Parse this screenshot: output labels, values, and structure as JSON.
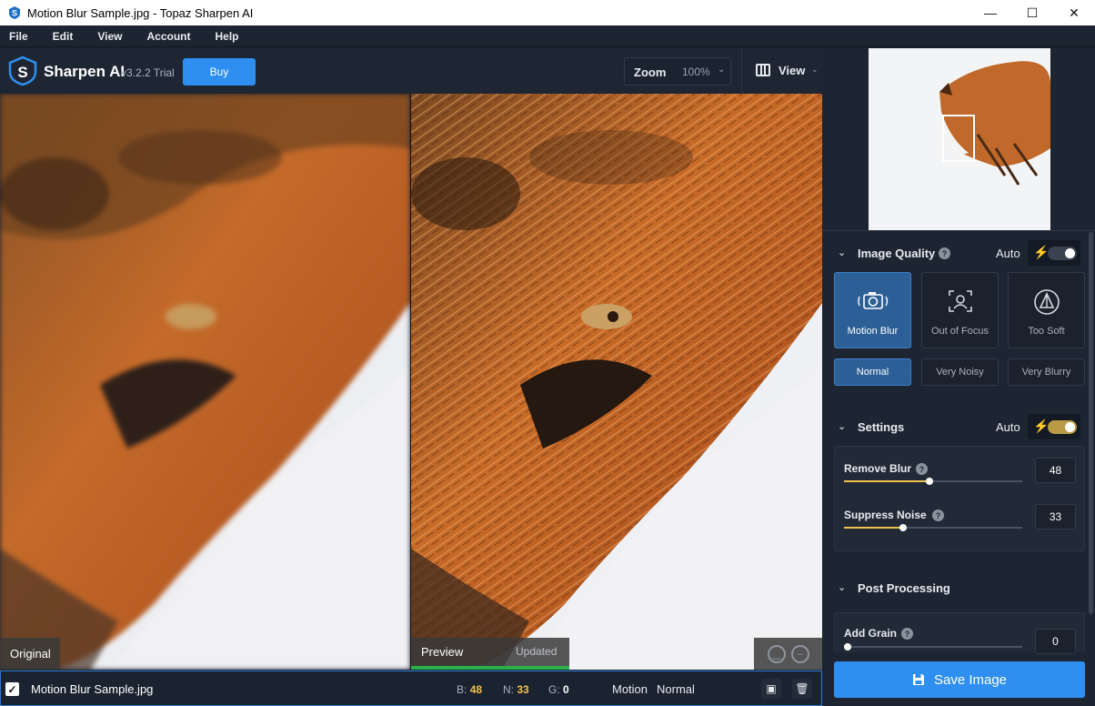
{
  "window": {
    "title": "Motion Blur Sample.jpg - Topaz Sharpen AI",
    "minimize": "—",
    "maximize": "☐",
    "close": "✕"
  },
  "menu": [
    "File",
    "Edit",
    "View",
    "Account",
    "Help"
  ],
  "toolbar": {
    "brand": "Sharpen AI",
    "version": "v3.2.2 Trial",
    "buy_label": "Buy",
    "zoom_label": "Zoom",
    "zoom_value": "100%",
    "view_label": "View"
  },
  "panes": {
    "original_label": "Original",
    "preview_label": "Preview",
    "preview_status": "Updated"
  },
  "status": {
    "filename": "Motion Blur Sample.jpg",
    "b_label": "B:",
    "b_value": "48",
    "n_label": "N:",
    "n_value": "33",
    "g_label": "G:",
    "g_value": "0",
    "mode_label": "Motion",
    "mode_value": "Normal"
  },
  "image_quality": {
    "title": "Image Quality",
    "auto_label": "Auto",
    "auto_enabled": false,
    "models": [
      {
        "label": "Motion Blur",
        "icon": "motion-blur-camera-icon",
        "selected": true
      },
      {
        "label": "Out of Focus",
        "icon": "out-of-focus-icon",
        "selected": false
      },
      {
        "label": "Too Soft",
        "icon": "too-soft-icon",
        "selected": false
      }
    ],
    "noise_levels": [
      {
        "label": "Normal",
        "selected": true
      },
      {
        "label": "Very Noisy",
        "selected": false
      },
      {
        "label": "Very Blurry",
        "selected": false
      }
    ]
  },
  "settings": {
    "title": "Settings",
    "auto_label": "Auto",
    "auto_enabled": true,
    "remove_blur": {
      "label": "Remove Blur",
      "value": "48"
    },
    "suppress_noise": {
      "label": "Suppress Noise",
      "value": "33"
    }
  },
  "post_processing": {
    "title": "Post Processing",
    "add_grain": {
      "label": "Add Grain",
      "value": "0"
    }
  },
  "save_label": "Save Image",
  "colors": {
    "accent": "#2e8ff0",
    "selected": "#2c5f96",
    "slider_fill": "#f0c14b",
    "updated_bar": "#28b14a"
  }
}
